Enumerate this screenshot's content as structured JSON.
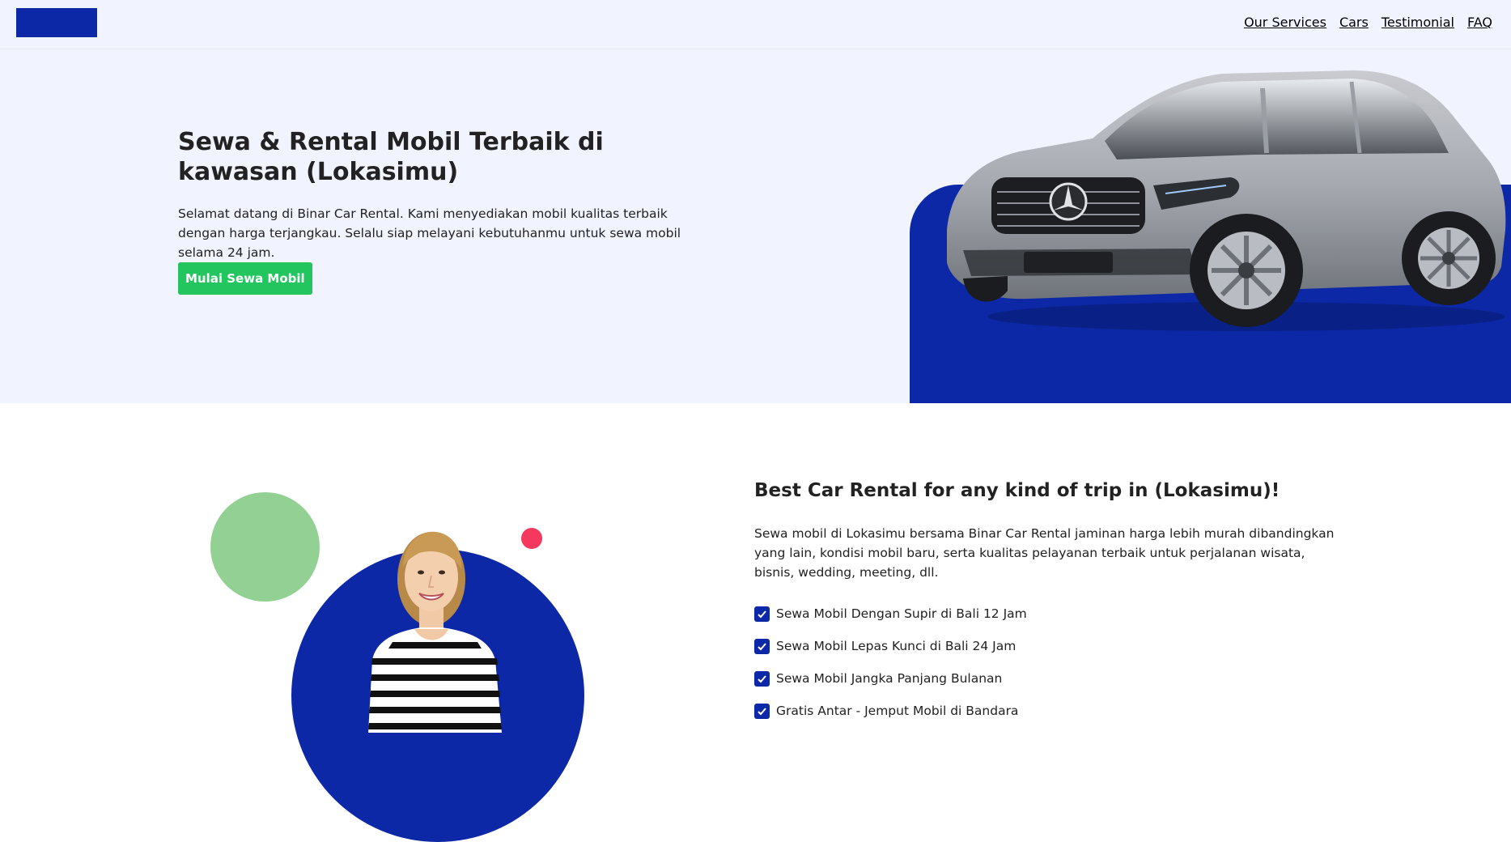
{
  "nav": {
    "links": [
      "Our Services",
      "Cars",
      "Testimonial",
      "FAQ"
    ]
  },
  "hero": {
    "title": "Sewa & Rental Mobil Terbaik di kawasan (Lokasimu)",
    "description": "Selamat datang di Binar Car Rental. Kami menyediakan mobil kualitas terbaik dengan harga terjangkau. Selalu siap melayani kebutuhanmu untuk sewa mobil selama 24 jam.",
    "cta_label": "Mulai Sewa Mobil"
  },
  "services": {
    "title": "Best Car Rental for any kind of trip in (Lokasimu)!",
    "description": "Sewa mobil di Lokasimu bersama Binar Car Rental jaminan harga lebih murah dibandingkan yang lain, kondisi mobil baru, serta kualitas pelayanan terbaik untuk perjalanan wisata, bisnis, wedding, meeting, dll.",
    "items": [
      "Sewa Mobil Dengan Supir di Bali 12 Jam",
      "Sewa Mobil Lepas Kunci di Bali 24 Jam",
      "Sewa Mobil Jangka Panjang Bulanan",
      "Gratis Antar - Jemput Mobil di Bandara"
    ]
  },
  "colors": {
    "brand_blue": "#0d28a6",
    "hero_bg": "#f1f3fe",
    "cta_green": "#22c55e",
    "accent_green": "#93d093",
    "accent_red": "#f4385e"
  },
  "icons": {
    "check": "checkbox-checked-icon"
  }
}
